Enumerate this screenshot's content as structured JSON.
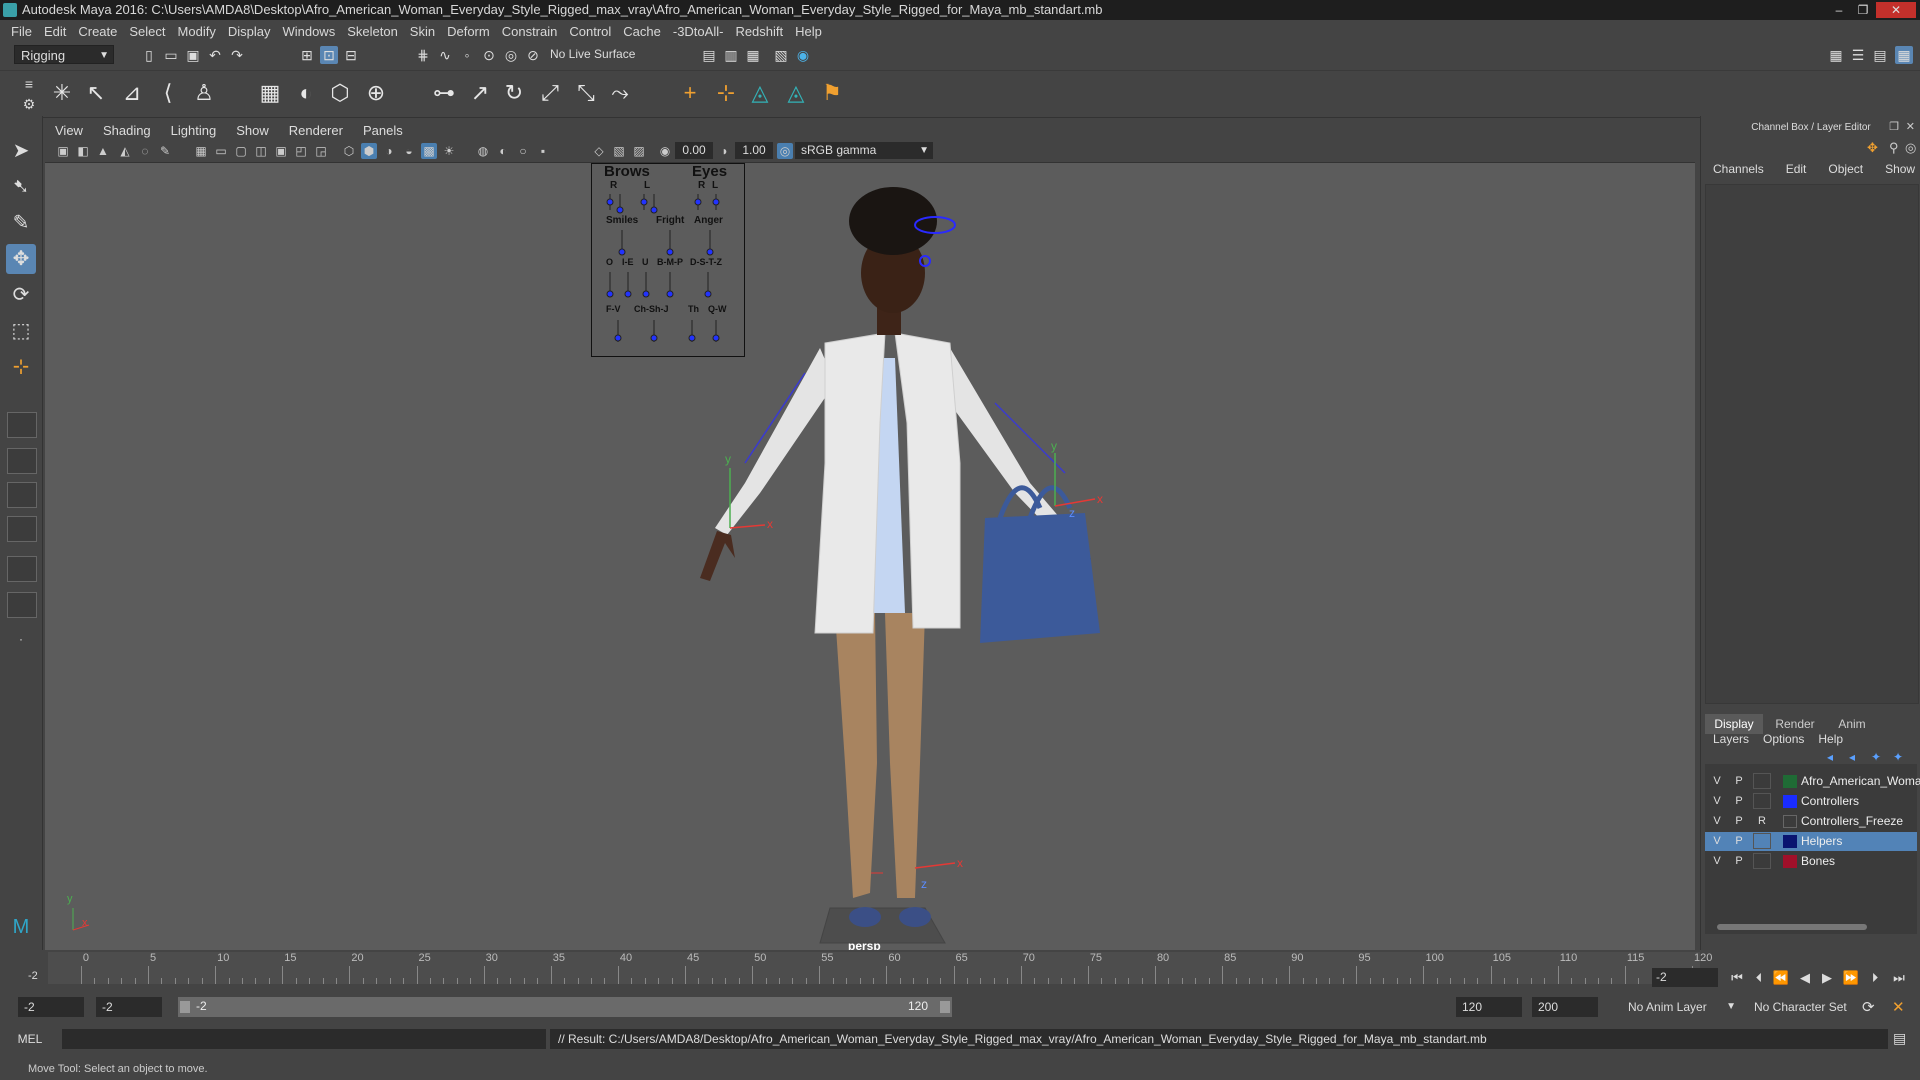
{
  "window": {
    "title": "Autodesk Maya 2016: C:\\Users\\AMDA8\\Desktop\\Afro_American_Woman_Everyday_Style_Rigged_max_vray\\Afro_American_Woman_Everyday_Style_Rigged_for_Maya_mb_standart.mb",
    "controls": [
      "–",
      "❐",
      "✕"
    ]
  },
  "menubar": [
    "File",
    "Edit",
    "Create",
    "Select",
    "Modify",
    "Display",
    "Windows",
    "Skeleton",
    "Skin",
    "Deform",
    "Constrain",
    "Control",
    "Cache",
    "-3DtoAll-",
    "Redshift",
    "Help"
  ],
  "statusline": {
    "mode": "Rigging",
    "live_surface": "No Live Surface"
  },
  "viewport": {
    "menu": [
      "View",
      "Shading",
      "Lighting",
      "Show",
      "Renderer",
      "Panels"
    ],
    "exposure": "0.00",
    "gamma": "1.00",
    "color_space": "sRGB gamma",
    "camera_label": "persp",
    "face_board": {
      "brows": "Brows",
      "eyes": "Eyes",
      "brows_rl": [
        "R",
        "L"
      ],
      "eyes_rl": [
        "R",
        "L"
      ],
      "row2": [
        "Smiles",
        "Fright",
        "Anger"
      ],
      "row3": [
        "O",
        "I-E",
        "U",
        "B-M-P",
        "D-S-T-Z"
      ],
      "row4": [
        "F-V",
        "Ch-Sh-J",
        "Th",
        "Q-W"
      ]
    },
    "axis": {
      "x": "x",
      "y": "y",
      "z": "z"
    }
  },
  "channel_box": {
    "title": "Channel Box / Layer Editor",
    "menu": [
      "Channels",
      "Edit",
      "Object",
      "Show"
    ]
  },
  "layer_editor": {
    "tabs": [
      "Display",
      "Render",
      "Anim"
    ],
    "menu": [
      "Layers",
      "Options",
      "Help"
    ],
    "layers": [
      {
        "v": "V",
        "p": "P",
        "r": "",
        "name": "Afro_American_Woman",
        "color": "#1f6b35",
        "selected": false
      },
      {
        "v": "V",
        "p": "P",
        "r": "",
        "name": "Controllers",
        "color": "#1a2cff",
        "selected": false
      },
      {
        "v": "V",
        "p": "P",
        "r": "R",
        "name": "Controllers_Freeze",
        "color": "",
        "selected": false
      },
      {
        "v": "V",
        "p": "P",
        "r": "",
        "name": "Helpers",
        "color": "#0a1470",
        "selected": true
      },
      {
        "v": "V",
        "p": "P",
        "r": "",
        "name": "Bones",
        "color": "#a0102a",
        "selected": false
      }
    ]
  },
  "timeline": {
    "ticks": [
      0,
      5,
      10,
      15,
      20,
      25,
      30,
      35,
      40,
      45,
      50,
      55,
      60,
      65,
      70,
      75,
      80,
      85,
      90,
      95,
      100,
      105,
      110,
      115,
      120
    ],
    "current_marker": "-2",
    "current_frame": "-2"
  },
  "range": {
    "start": "-2",
    "playback_start": "-2",
    "slider_start": "-2",
    "slider_end": "120",
    "playback_end": "120",
    "end": "200",
    "anim_layer": "No Anim Layer",
    "character_set": "No Character Set"
  },
  "command": {
    "language": "MEL",
    "result": "// Result: C:/Users/AMDA8/Desktop/Afro_American_Woman_Everyday_Style_Rigged_max_vray/Afro_American_Woman_Everyday_Style_Rigged_for_Maya_mb_standart.mb"
  },
  "help_line": "Move Tool: Select an object to move."
}
